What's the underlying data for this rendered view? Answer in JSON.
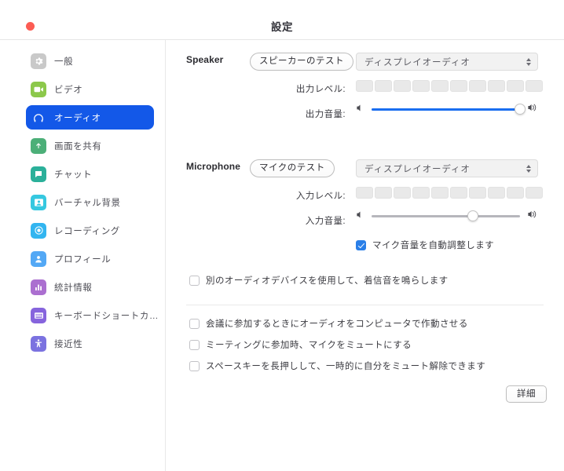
{
  "window": {
    "title": "設定",
    "close_button": "close-button"
  },
  "sidebar": {
    "items": [
      {
        "label": "一般",
        "icon": "gear-icon",
        "color": "#c9c9c9",
        "active": false
      },
      {
        "label": "ビデオ",
        "icon": "video-icon",
        "color": "#8cc84b",
        "active": false
      },
      {
        "label": "オーディオ",
        "icon": "headphones-icon",
        "color": "#1358e8",
        "active": true
      },
      {
        "label": "画面を共有",
        "icon": "share-screen-icon",
        "color": "#4caf78",
        "active": false
      },
      {
        "label": "チャット",
        "icon": "chat-icon",
        "color": "#2bb09a",
        "active": false
      },
      {
        "label": "バーチャル背景",
        "icon": "virtual-bg-icon",
        "color": "#35c8e0",
        "active": false
      },
      {
        "label": "レコーディング",
        "icon": "record-icon",
        "color": "#32b5f0",
        "active": false
      },
      {
        "label": "プロフィール",
        "icon": "profile-icon",
        "color": "#53a8f5",
        "active": false
      },
      {
        "label": "統計情報",
        "icon": "statistics-icon",
        "color": "#ab6fd0",
        "active": false
      },
      {
        "label": "キーボードショートカ…",
        "icon": "keyboard-icon",
        "color": "#8664dd",
        "active": false
      },
      {
        "label": "接近性",
        "icon": "accessibility-icon",
        "color": "#7b72e0",
        "active": false
      }
    ]
  },
  "speaker": {
    "section_label": "Speaker",
    "test_button": "スピーカーのテスト",
    "device": "ディスプレイオーディオ",
    "output_level_label": "出力レベル:",
    "output_level_segments": 10,
    "output_level_active": 0,
    "output_volume_label": "出力音量:",
    "output_volume_percent": 100,
    "output_volume_filled": true
  },
  "microphone": {
    "section_label": "Microphone",
    "test_button": "マイクのテスト",
    "device": "ディスプレイオーディオ",
    "input_level_label": "入力レベル:",
    "input_level_segments": 10,
    "input_level_active": 0,
    "input_volume_label": "入力音量:",
    "input_volume_percent": 68,
    "input_volume_filled": false,
    "auto_adjust": {
      "label": "マイク音量を自動調整します",
      "checked": true
    }
  },
  "options": {
    "ringtone": {
      "label": "別のオーディオデバイスを使用して、着信音を鳴らします",
      "checked": false
    },
    "join_audio": {
      "label": "会議に参加するときにオーディオをコンピュータで作動させる",
      "checked": false
    },
    "mute_on_join": {
      "label": "ミーティングに参加時、マイクをミュートにする",
      "checked": false
    },
    "space_unmute": {
      "label": "スペースキーを長押しして、一時的に自分をミュート解除できます",
      "checked": false
    }
  },
  "footer": {
    "advanced_button": "詳細"
  },
  "theme": {
    "accent": "#1358e8",
    "slider_blue": "#1a6ef0",
    "checkbox_blue": "#2a7fe8",
    "close_red": "#fc5c53"
  }
}
